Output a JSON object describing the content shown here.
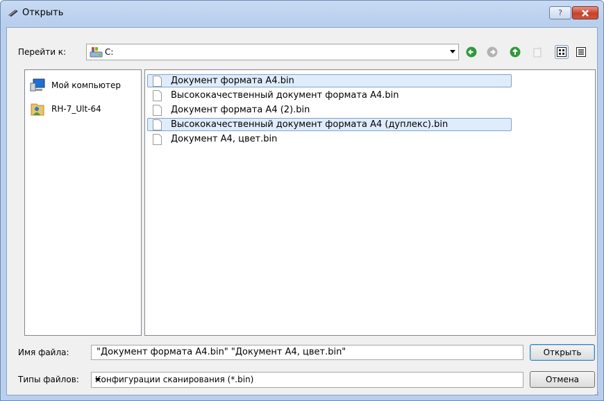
{
  "window": {
    "title": "Открыть"
  },
  "titlebar": {
    "help_label": "?"
  },
  "navigation": {
    "goto_label": "Перейти к:",
    "location": "C:"
  },
  "places": [
    {
      "label": "Мой компьютер",
      "icon": "computer-icon"
    },
    {
      "label": "RH-7_Ult-64",
      "icon": "user-folder-icon"
    }
  ],
  "files": [
    {
      "name": "Документ формата A4.bin",
      "selected": true
    },
    {
      "name": "Высококачественный документ формата A4.bin",
      "selected": false
    },
    {
      "name": "Документ формата A4 (2).bin",
      "selected": false
    },
    {
      "name": "Высококачественный документ формата A4 (дуплекс).bin",
      "selected": true
    },
    {
      "name": "Документ A4, цвет.bin",
      "selected": false
    }
  ],
  "form": {
    "filename_label": "Имя файла:",
    "filename_value": "\"Документ формата A4.bin\"  \"Документ A4, цвет.bin\"",
    "filetype_label": "Типы файлов:",
    "filetype_value": "Конфигурации сканирования (*.bin)"
  },
  "buttons": {
    "open": "Открыть",
    "cancel": "Отмена"
  },
  "colors": {
    "accent": "#3c7fb1",
    "selection": "#dfecfb",
    "nav_green": "#2f9a3a",
    "close": "#c7412a"
  }
}
